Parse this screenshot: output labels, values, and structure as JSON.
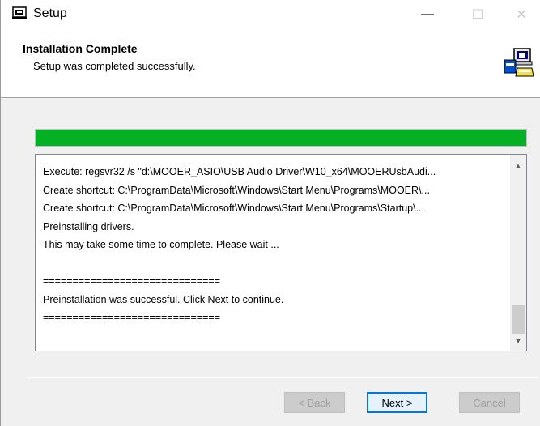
{
  "window": {
    "title": "Setup",
    "minimize_glyph": "—",
    "maximize_glyph": "☐",
    "close_glyph": "✕"
  },
  "header": {
    "title": "Installation Complete",
    "subtitle": "Setup was completed successfully.",
    "icon": "installer-computer-icon"
  },
  "progress": {
    "fraction": 1.0,
    "color": "#06b025"
  },
  "log": {
    "lines": [
      "Execute: regsvr32 /s \"d:\\MOOER_ASIO\\USB Audio Driver\\W10_x64\\MOOERUsbAudi...",
      "Create shortcut: C:\\ProgramData\\Microsoft\\Windows\\Start Menu\\Programs\\MOOER\\...",
      "Create shortcut: C:\\ProgramData\\Microsoft\\Windows\\Start Menu\\Programs\\Startup\\...",
      "Preinstalling drivers.",
      "This may take some time to complete. Please wait ...",
      "",
      "==============================",
      "Preinstallation was successful. Click Next to continue.",
      "=============================="
    ],
    "scroll_up_glyph": "▲",
    "scroll_down_glyph": "▼"
  },
  "buttons": {
    "back": "< Back",
    "next": "Next >",
    "cancel": "Cancel"
  }
}
